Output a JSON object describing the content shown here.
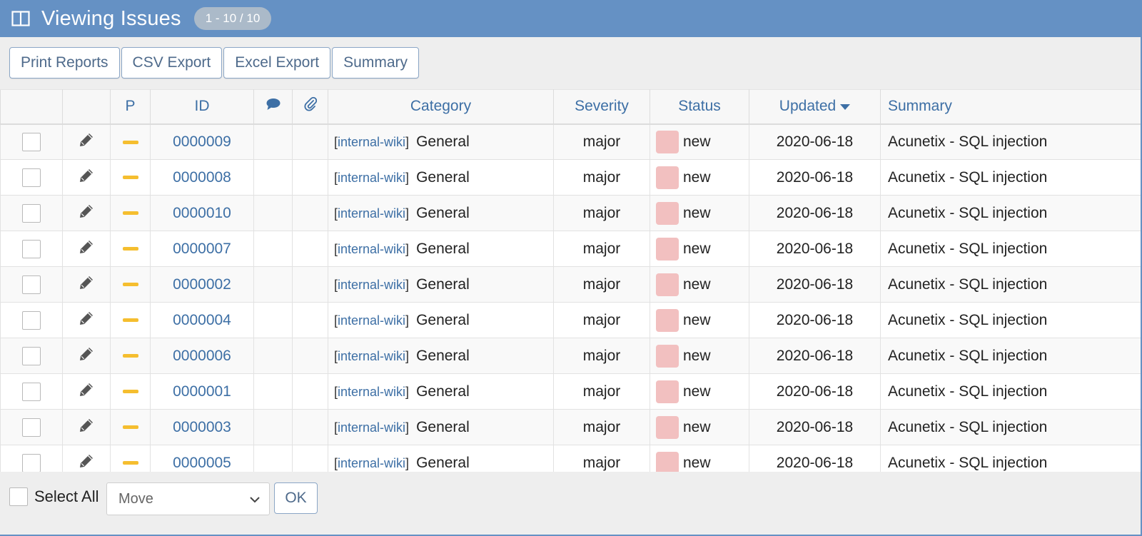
{
  "header": {
    "title": "Viewing Issues",
    "range_badge": "1 - 10 / 10"
  },
  "toolbar": {
    "buttons": [
      "Print Reports",
      "CSV Export",
      "Excel Export",
      "Summary"
    ]
  },
  "table": {
    "columns": {
      "priority": "P",
      "id": "ID",
      "notes_icon": "comments-icon",
      "attachments_icon": "paperclip-icon",
      "category": "Category",
      "severity": "Severity",
      "status": "Status",
      "updated": "Updated",
      "summary": "Summary"
    },
    "rows": [
      {
        "id": "0000009",
        "project": "internal-wiki",
        "category": "General",
        "severity": "major",
        "status": "new",
        "updated": "2020-06-18",
        "summary": "Acunetix - SQL injection"
      },
      {
        "id": "0000008",
        "project": "internal-wiki",
        "category": "General",
        "severity": "major",
        "status": "new",
        "updated": "2020-06-18",
        "summary": "Acunetix - SQL injection"
      },
      {
        "id": "0000010",
        "project": "internal-wiki",
        "category": "General",
        "severity": "major",
        "status": "new",
        "updated": "2020-06-18",
        "summary": "Acunetix - SQL injection"
      },
      {
        "id": "0000007",
        "project": "internal-wiki",
        "category": "General",
        "severity": "major",
        "status": "new",
        "updated": "2020-06-18",
        "summary": "Acunetix - SQL injection"
      },
      {
        "id": "0000002",
        "project": "internal-wiki",
        "category": "General",
        "severity": "major",
        "status": "new",
        "updated": "2020-06-18",
        "summary": "Acunetix - SQL injection"
      },
      {
        "id": "0000004",
        "project": "internal-wiki",
        "category": "General",
        "severity": "major",
        "status": "new",
        "updated": "2020-06-18",
        "summary": "Acunetix - SQL injection"
      },
      {
        "id": "0000006",
        "project": "internal-wiki",
        "category": "General",
        "severity": "major",
        "status": "new",
        "updated": "2020-06-18",
        "summary": "Acunetix - SQL injection"
      },
      {
        "id": "0000001",
        "project": "internal-wiki",
        "category": "General",
        "severity": "major",
        "status": "new",
        "updated": "2020-06-18",
        "summary": "Acunetix - SQL injection"
      },
      {
        "id": "0000003",
        "project": "internal-wiki",
        "category": "General",
        "severity": "major",
        "status": "new",
        "updated": "2020-06-18",
        "summary": "Acunetix - SQL injection"
      },
      {
        "id": "0000005",
        "project": "internal-wiki",
        "category": "General",
        "severity": "major",
        "status": "new",
        "updated": "2020-06-18",
        "summary": "Acunetix - SQL injection"
      }
    ]
  },
  "footer": {
    "select_all_label": "Select All",
    "action_select_value": "Move",
    "ok_label": "OK"
  },
  "colors": {
    "header_bg": "#6591c4",
    "link": "#3d6fa5",
    "priority_normal": "#f5be2f",
    "status_new": "#f2c0c0"
  }
}
